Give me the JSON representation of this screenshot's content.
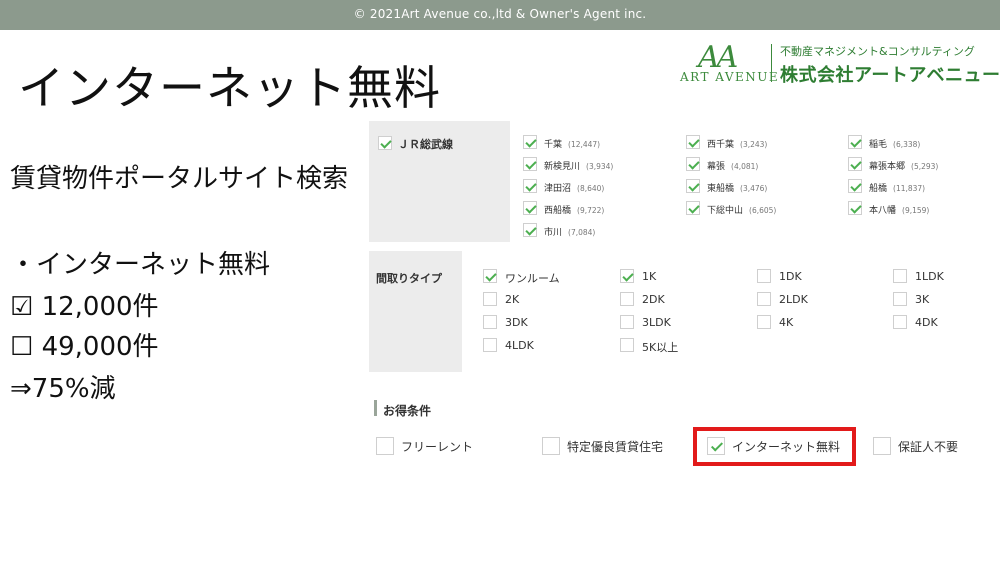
{
  "header": {
    "copyright": "©  2021Art Avenue co.,ltd & Owner's Agent inc."
  },
  "slide": {
    "title": "インターネット無料",
    "subtitle": "賃貸物件ポータルサイト検索",
    "bullet": "・インターネット無料",
    "checked_line": "☑  12,000件",
    "unchecked_line": "☐  49,000件",
    "result": "⇒75%減"
  },
  "logo": {
    "mark": "AA",
    "art_avenue": "ART AVENUE",
    "tagline": "不動産マネジメント&コンサルティング",
    "company": "株式会社アートアベニュー",
    "color": "#2e7d32"
  },
  "line_section": {
    "label": "ＪＲ総武線",
    "checked": true,
    "stations": [
      {
        "name": "千葉",
        "count": "(12,447)",
        "checked": true
      },
      {
        "name": "西千葉",
        "count": "(3,243)",
        "checked": true
      },
      {
        "name": "稲毛",
        "count": "(6,338)",
        "checked": true
      },
      {
        "name": "新検見川",
        "count": "(3,934)",
        "checked": true
      },
      {
        "name": "幕張",
        "count": "(4,081)",
        "checked": true
      },
      {
        "name": "幕張本郷",
        "count": "(5,293)",
        "checked": true
      },
      {
        "name": "津田沼",
        "count": "(8,640)",
        "checked": true
      },
      {
        "name": "東船橋",
        "count": "(3,476)",
        "checked": true
      },
      {
        "name": "船橋",
        "count": "(11,837)",
        "checked": true
      },
      {
        "name": "西船橋",
        "count": "(9,722)",
        "checked": true
      },
      {
        "name": "下総中山",
        "count": "(6,605)",
        "checked": true
      },
      {
        "name": "本八幡",
        "count": "(9,159)",
        "checked": true
      },
      {
        "name": "市川",
        "count": "(7,084)",
        "checked": true
      }
    ]
  },
  "layout_section": {
    "label": "間取りタイプ",
    "options": [
      {
        "name": "ワンルーム",
        "checked": true
      },
      {
        "name": "1K",
        "checked": true
      },
      {
        "name": "1DK",
        "checked": false
      },
      {
        "name": "1LDK",
        "checked": false
      },
      {
        "name": "2K",
        "checked": false
      },
      {
        "name": "2DK",
        "checked": false
      },
      {
        "name": "2LDK",
        "checked": false
      },
      {
        "name": "3K",
        "checked": false
      },
      {
        "name": "3DK",
        "checked": false
      },
      {
        "name": "3LDK",
        "checked": false
      },
      {
        "name": "4K",
        "checked": false
      },
      {
        "name": "4DK",
        "checked": false
      },
      {
        "name": "4LDK",
        "checked": false
      },
      {
        "name": "5K以上",
        "checked": false
      }
    ]
  },
  "deals_section": {
    "label": "お得条件",
    "options": [
      {
        "name": "フリーレント",
        "checked": false
      },
      {
        "name": "特定優良賃貸住宅",
        "checked": false
      },
      {
        "name": "インターネット無料",
        "checked": true
      },
      {
        "name": "保証人不要",
        "checked": false
      }
    ],
    "highlight_color": "#e21a1a",
    "check_color": "#4caf50"
  }
}
